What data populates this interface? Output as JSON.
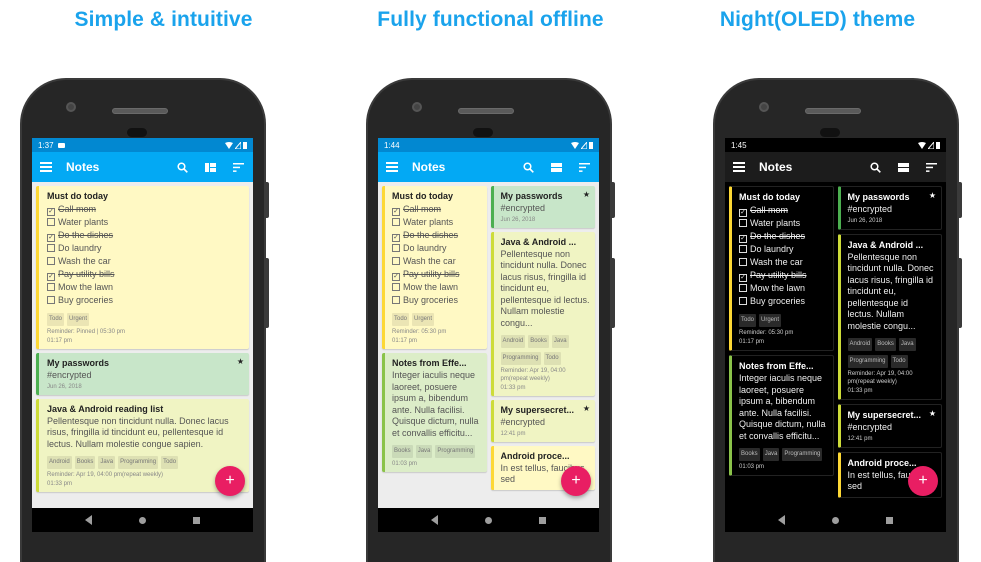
{
  "headlines": [
    "Simple & intuitive",
    "Fully functional offline",
    "Night(OLED) theme"
  ],
  "colors": {
    "headline": "#1aa3ec",
    "appbar_light": "#03a9f4",
    "statusbar_light": "#0288d1",
    "fab": "#e91e63",
    "note_yellow": "#fff9c4",
    "note_green": "#c8e6c9",
    "note_lime": "#f0f4c3",
    "note_lightgreen": "#dcedc8"
  },
  "app": {
    "title": "Notes",
    "icons": [
      "menu-icon",
      "search-icon",
      "layout-icon",
      "sort-icon"
    ],
    "fab_label": "+"
  },
  "phones": [
    {
      "time": "1:37",
      "notes": {
        "todo": {
          "title": "Must do today",
          "items": [
            {
              "text": "Call mom",
              "done": true
            },
            {
              "text": "Water plants",
              "done": false
            },
            {
              "text": "Do the dishes",
              "done": true
            },
            {
              "text": "Do laundry",
              "done": false
            },
            {
              "text": "Wash the car",
              "done": false
            },
            {
              "text": "Pay utility bills",
              "done": true
            },
            {
              "text": "Mow the lawn",
              "done": false
            },
            {
              "text": "Buy groceries",
              "done": false
            }
          ],
          "tags": [
            "Todo",
            "Urgent"
          ],
          "reminder": "Reminder: Pinned | 05:30 pm",
          "time": "01:17 pm"
        },
        "passwords": {
          "title": "My passwords",
          "body": "#encrypted",
          "date": "Jun 26, 2018",
          "star": "★"
        },
        "reading": {
          "title": "Java & Android reading list",
          "body": "Pellentesque non tincidunt nulla. Donec lacus risus, fringilla id tincidunt eu, pellentesque id lectus. Nullam molestie congue sapien.",
          "tags": [
            "Android",
            "Books",
            "Java",
            "Programming",
            "Todo"
          ],
          "reminder": "Reminder: Apr 19, 04:00 pm(repeat weekly)",
          "time": "01:33 pm"
        }
      }
    },
    {
      "time": "1:44",
      "left": {
        "todo": {
          "title": "Must do today",
          "items": [
            {
              "text": "Call mom",
              "done": true
            },
            {
              "text": "Water plants",
              "done": false
            },
            {
              "text": "Do the dishes",
              "done": true
            },
            {
              "text": "Do laundry",
              "done": false
            },
            {
              "text": "Wash the car",
              "done": false
            },
            {
              "text": "Pay utility bills",
              "done": true
            },
            {
              "text": "Mow the lawn",
              "done": false
            },
            {
              "text": "Buy groceries",
              "done": false
            }
          ],
          "tags": [
            "Todo",
            "Urgent"
          ],
          "reminder": "Reminder: 05:30 pm",
          "time": "01:17 pm"
        },
        "effective": {
          "title": "Notes from Effe...",
          "body": "Integer iaculis neque laoreet, posuere ipsum a, bibendum ante. Nulla facilisi. Quisque dictum, nulla et convallis efficitu...",
          "tags": [
            "Books",
            "Java",
            "Programming"
          ],
          "time": "01:03 pm"
        }
      },
      "right": {
        "passwords": {
          "title": "My passwords",
          "body": "#encrypted",
          "date": "Jun 26, 2018",
          "star": "★"
        },
        "reading": {
          "title": "Java & Android ...",
          "body": "Pellentesque non tincidunt nulla. Donec lacus risus, fringilla id tincidunt eu, pellentesque id lectus. Nullam molestie congu...",
          "tags": [
            "Android",
            "Books",
            "Java",
            "Programming",
            "Todo"
          ],
          "reminder": "Reminder: Apr 19, 04:00 pm(repeat weekly)",
          "time": "01:33 pm"
        },
        "supersecret": {
          "title": "My supersecret...",
          "body": "#encrypted",
          "time": "12:41 pm",
          "star": "★"
        },
        "android": {
          "title": "Android proce...",
          "body": "In est tellus, faucibus sed"
        }
      }
    },
    {
      "time": "1:45"
    }
  ]
}
